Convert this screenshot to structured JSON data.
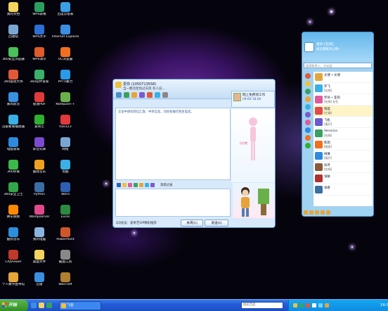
{
  "desktop_icons": [
    {
      "label": "我的文档",
      "color": "#f4d35e"
    },
    {
      "label": "回收站",
      "color": "#7aa6d4"
    },
    {
      "label": "360安全浏览器",
      "color": "#4bbf5a"
    },
    {
      "label": "360驱动大师",
      "color": "#e05a3a"
    },
    {
      "label": "暴风影音",
      "color": "#3a8fe0"
    },
    {
      "label": "迅雷看看播放器",
      "color": "#3ab0e6"
    },
    {
      "label": "电脑管家",
      "color": "#2d8ae0"
    },
    {
      "label": "360杀毒",
      "color": "#3cb84a"
    },
    {
      "label": "360安全卫士",
      "color": "#33a54a"
    },
    {
      "label": "腾讯视频",
      "color": "#ff8a00"
    },
    {
      "label": "酷狗音乐",
      "color": "#2b8fe0"
    },
    {
      "label": "CAJViewer",
      "color": "#c0392b"
    },
    {
      "label": "个人数字图书馆",
      "color": "#e6a53a"
    },
    {
      "label": "WPS表格",
      "color": "#2aa060"
    },
    {
      "label": "WPS文字",
      "color": "#2d6fd6"
    },
    {
      "label": "WPS演示",
      "color": "#e05a2a"
    },
    {
      "label": "360软件管家",
      "color": "#3ab06a"
    },
    {
      "label": "极速PDF",
      "color": "#e03a3a"
    },
    {
      "label": "爱奇艺",
      "color": "#30b030"
    },
    {
      "label": "影音先锋",
      "color": "#7a4ad0"
    },
    {
      "label": "酷我音乐",
      "color": "#f0a020"
    },
    {
      "label": "Python",
      "color": "#3a6ea5"
    },
    {
      "label": "Wampserver",
      "color": "#e04a8a"
    },
    {
      "label": "我的电脑",
      "color": "#8ab4e0"
    },
    {
      "label": "桌面文件",
      "color": "#f4d35e"
    },
    {
      "label": "迅雷",
      "color": "#3a8fe0"
    },
    {
      "label": "百度云管家",
      "color": "#3aa0e6"
    },
    {
      "label": "Internet Explorer",
      "color": "#3a8fe0"
    },
    {
      "label": "UC浏览器",
      "color": "#f07020"
    },
    {
      "label": "PPTV聚力",
      "color": "#2a9ae6"
    },
    {
      "label": "Notepad++",
      "color": "#6ab04a"
    },
    {
      "label": "hao123",
      "color": "#e03a3a"
    },
    {
      "label": "网络",
      "color": "#7aa6d4"
    },
    {
      "label": "优酷",
      "color": "#3ab0e6"
    },
    {
      "label": "Word",
      "color": "#2d5fb0"
    },
    {
      "label": "Excel",
      "color": "#2a8a40"
    },
    {
      "label": "PowerPoint",
      "color": "#d0562a"
    },
    {
      "label": "截图工具",
      "color": "#888888"
    },
    {
      "label": "Warcraft",
      "color": "#b08030"
    }
  ],
  "chat": {
    "title": "爱你 (1050713558)",
    "subtitle": "当一颗流星划过天际 有人说...",
    "peer_name": "网上免费领工作",
    "peer_time": "09:00-18:00",
    "system_message": "交谈中请勿轻信汇款、中奖信息，勿轻易拨打陌生电话。",
    "show_label": "QQ秀",
    "message_log": "消息记录",
    "footer_ad": "QQ会员：爱奇艺VIP精彩推荐",
    "close_button": "关闭(C)",
    "send_button": "发送(S)"
  },
  "qq_panel": {
    "nickname": "爱你",
    "status": "[在线]",
    "signature": "每天都要开心哦~",
    "search_placeholder": "搜索联系人、讨论组",
    "contacts": [
      {
        "name": "文博 • 文博",
        "status": "",
        "color": "#e6a53a"
      },
      {
        "name": "罗飞",
        "status": "[在线]",
        "color": "#3ab0e6"
      },
      {
        "name": "罗琦 • 亚莉",
        "status": "[在线] 在忙",
        "color": "#e05a9c"
      },
      {
        "name": "晓霞",
        "status": "[忙碌]",
        "color": "#e04a4a",
        "hl": true
      },
      {
        "name": "飞机",
        "status": "[离开]",
        "color": "#6a5ad0"
      },
      {
        "name": "Veronica",
        "status": "[在线]",
        "color": "#3aa060"
      },
      {
        "name": "陈雨",
        "status": "[隐身]",
        "color": "#f07020"
      },
      {
        "name": "林琳",
        "status": "[离开]",
        "color": "#2d8ae0"
      },
      {
        "name": "徐月",
        "status": "[在线]",
        "color": "#8a5a3a"
      },
      {
        "name": "张敏",
        "status": "",
        "color": "#b03030"
      },
      {
        "name": "张春",
        "status": "",
        "color": "#3a6ea5"
      }
    ]
  },
  "taskbar": {
    "start_label": "开始",
    "task_label": "飞音",
    "search_placeholder": "搜索百度",
    "clock": "16:52"
  }
}
